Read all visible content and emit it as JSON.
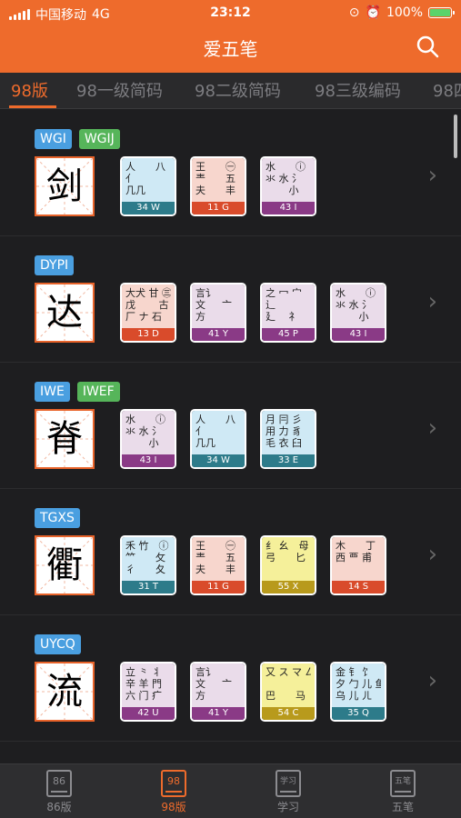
{
  "status": {
    "carrier": "中国移动",
    "network": "4G",
    "time": "23:12",
    "battery": "100%"
  },
  "header": {
    "title": "爱五笔"
  },
  "tabs": [
    "98版",
    "98一级简码",
    "98二级简码",
    "98三级编码",
    "98四"
  ],
  "rows": [
    {
      "codes": [
        "WGI",
        "WGIJ"
      ],
      "char": "剑",
      "keys": [
        {
          "color": "blue",
          "lines": [
            "人　　八",
            "亻　　　",
            "几几　　"
          ],
          "foot": "34 W"
        },
        {
          "color": "red",
          "lines": [
            "王　　㊀",
            "龶　　五",
            "夫　　丰"
          ],
          "foot": "11 G"
        },
        {
          "color": "purple",
          "lines": [
            "水　　ⓘ",
            "氺 水 氵",
            "　　 小"
          ],
          "foot": "43 I"
        }
      ]
    },
    {
      "codes": [
        "DYPI"
      ],
      "char": "达",
      "keys": [
        {
          "color": "red",
          "lines": [
            "大犬 甘 ㊂",
            "戊 　　古",
            "厂 ナ 石"
          ],
          "foot": "13 D"
        },
        {
          "color": "purple",
          "lines": [
            "言讠　　",
            "文 　 亠",
            "方　　"
          ],
          "foot": "41 Y"
        },
        {
          "color": "purple",
          "lines": [
            "之 冖 宀",
            "辶　　",
            "廴　 礻"
          ],
          "foot": "45 P"
        },
        {
          "color": "purple",
          "lines": [
            "水　　ⓘ",
            "氺 水 氵",
            "　　 小"
          ],
          "foot": "43 I"
        }
      ]
    },
    {
      "codes": [
        "IWE",
        "IWEF"
      ],
      "char": "脊",
      "keys": [
        {
          "color": "purple",
          "lines": [
            "水　　ⓘ",
            "氺 水 氵",
            "　　 小"
          ],
          "foot": "43 I"
        },
        {
          "color": "blue",
          "lines": [
            "人　　八",
            "亻　　　",
            "几几　　"
          ],
          "foot": "34 W"
        },
        {
          "color": "blue",
          "lines": [
            "月 冃 彡",
            "用 力 豸",
            "毛 衣 臼"
          ],
          "foot": "33 E"
        }
      ]
    },
    {
      "codes": [
        "TGXS"
      ],
      "char": "衢",
      "keys": [
        {
          "color": "blue",
          "lines": [
            "禾 竹　ⓘ",
            "⺮　　攵",
            "彳　　夂"
          ],
          "foot": "31 T"
        },
        {
          "color": "red",
          "lines": [
            "王　　㊀",
            "龶　　五",
            "夫　　丰"
          ],
          "foot": "11 G"
        },
        {
          "color": "yellow",
          "lines": [
            "纟 幺　母",
            "弓　　匕",
            "　　　"
          ],
          "foot": "55 X"
        },
        {
          "color": "red",
          "lines": [
            "木　　丁",
            "西 覀 甫",
            "　　　"
          ],
          "foot": "14 S"
        }
      ]
    },
    {
      "codes": [
        "UYCQ"
      ],
      "char": "流",
      "keys": [
        {
          "color": "purple",
          "lines": [
            "立 ⺀ 丬",
            "辛 羊 門",
            "六 门 疒"
          ],
          "foot": "42 U"
        },
        {
          "color": "purple",
          "lines": [
            "言讠　　",
            "文 　 亠",
            "方　　"
          ],
          "foot": "41 Y"
        },
        {
          "color": "yellow",
          "lines": [
            "又 ス マ 厶",
            "　　　",
            "巴　　马"
          ],
          "foot": "54 C"
        },
        {
          "color": "blue",
          "lines": [
            "金 钅 饣",
            "夕 勹 儿 鱼",
            "乌 儿 ㄦ"
          ],
          "foot": "35 Q"
        }
      ]
    }
  ],
  "nav": [
    {
      "icon": "86",
      "label": "86版"
    },
    {
      "icon": "98",
      "label": "98版"
    },
    {
      "icon": "学习",
      "label": "学习"
    },
    {
      "icon": "五笔",
      "label": "五笔"
    }
  ]
}
